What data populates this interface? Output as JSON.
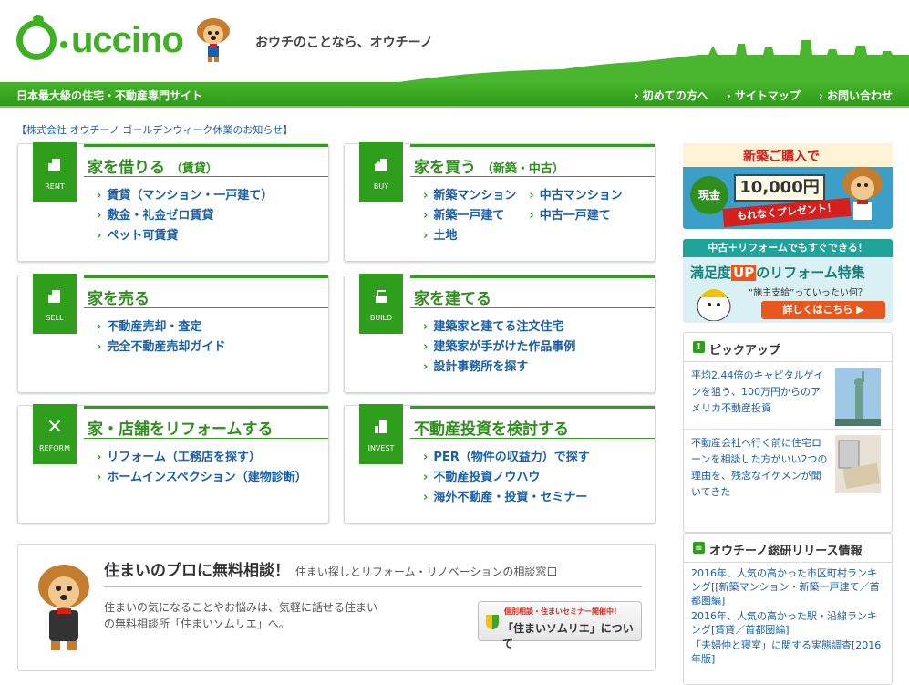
{
  "header": {
    "logo_text": "uccino",
    "tagline": "おウチのことなら、オウチーノ"
  },
  "navbar": {
    "site_desc": "日本最大級の住宅・不動産専門サイト",
    "links": [
      "初めての方へ",
      "サイトマップ",
      "お問い合わせ"
    ]
  },
  "notice": "【株式会社 オウチーノ ゴールデンウィーク休業のお知らせ】",
  "cards": {
    "rent": {
      "tag": "RENT",
      "title": "家を借りる",
      "sub": "（賃貸）",
      "links": [
        "賃貸（マンション・一戸建て）",
        "敷金・礼金ゼロ賃貸",
        "ペット可賃貸"
      ]
    },
    "buy": {
      "tag": "BUY",
      "title": "家を買う",
      "sub": "（新築・中古）",
      "links_col1": [
        "新築マンション",
        "新築一戸建て",
        "土地"
      ],
      "links_col2": [
        "中古マンション",
        "中古一戸建て"
      ]
    },
    "sell": {
      "tag": "SELL",
      "title": "家を売る",
      "links": [
        "不動産売却・査定",
        "完全不動産売却ガイド"
      ]
    },
    "build": {
      "tag": "BUILD",
      "title": "家を建てる",
      "links": [
        "建築家と建てる注文住宅",
        "建築家が手がけた作品事例",
        "設計事務所を探す"
      ]
    },
    "reform": {
      "tag": "REFORM",
      "title": "家・店舗をリフォームする",
      "links": [
        "リフォーム（工務店を探す）",
        "ホームインスペクション（建物診断）"
      ]
    },
    "invest": {
      "tag": "INVEST",
      "title": "不動産投資を検討する",
      "links": [
        "PER（物件の収益力）で探す",
        "不動産投資ノウハウ",
        "海外不動産・投資・セミナー"
      ]
    }
  },
  "consult": {
    "title": "住まいのプロに無料相談！",
    "title_sub": "住まい探しとリフォーム・リノベーションの相談窓口",
    "desc": "住まいの気になることやお悩みは、気軽に話せる住まいの無料相談所「住まいソムリエ」へ。",
    "btn_sub": "個別相談・住まいセミナー開催中！",
    "btn_main": "「住まいソムリエ」について"
  },
  "banner1": {
    "title": "新築ご購入で",
    "cash": "現金",
    "amount": "10,000円",
    "sub": "もれなくプレゼント！"
  },
  "banner2": {
    "top": "中古＋リフォームでもすぐできる！",
    "main_a": "満足度",
    "main_b": "UP",
    "main_c": "のリフォーム特集",
    "question": "“施主支給”っていったい何？",
    "btn": "詳しくはこちら ▶"
  },
  "pickup": {
    "title": "ピックアップ",
    "items": [
      "平均2.44倍のキャピタルゲインを狙う、100万円からのアメリカ不動産投資",
      "不動産会社へ行く前に住宅ローンを相談した方がいい2つの理由を、残念なイケメンが聞いてきた"
    ]
  },
  "release": {
    "title": "オウチーノ総研リリース情報",
    "items": [
      "2016年、人気の高かった市区町村ランキング[[新築マンション・新築一戸建て／首都圏編]",
      "2016年、人気の高かった駅・沿線ランキング[賃貸／首都圏編]",
      "「夫婦仲と寝室」に関する実態調査[2016年版]"
    ]
  },
  "colors": {
    "green": "#2f9e1d",
    "link": "#1a5fa8"
  }
}
